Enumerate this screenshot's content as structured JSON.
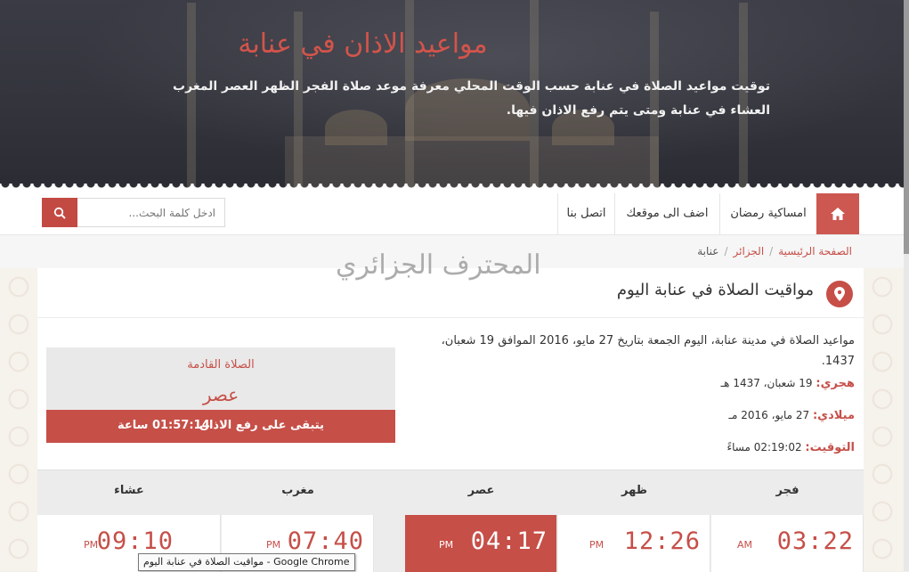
{
  "hero": {
    "title": "مواعيد الاذان في عنابة",
    "subtitle": "توقيت مواعيد الصلاة في عنابة حسب الوقت المحلي معرفة موعد صلاة الفجر الظهر العصر المغرب العشاء في عنابة ومتى يتم رفع الاذان فيها."
  },
  "nav": {
    "items": [
      "امساكية رمضان",
      "اضف الى موقعك",
      "اتصل بنا"
    ],
    "home_icon": "home-icon",
    "search_placeholder": "ادخل كلمة البحث...",
    "search_icon": "search-icon"
  },
  "breadcrumb": {
    "home": "الصفحة الرئيسية",
    "country": "الجزائر",
    "city": "عنابة"
  },
  "watermark": "المحترف الجزائري",
  "section": {
    "title": "مواقيت الصلاة في عنابة اليوم",
    "description": "مواعيد الصلاة في مدينة عنابة، اليوم الجمعة بتاريخ 27 مايو، 2016 الموافق 19 شعبان، 1437.",
    "hijri_label": "هجري:",
    "hijri_value": "19 شعبان، 1437 هـ",
    "gregorian_label": "ميلادي:",
    "gregorian_value": "27 مايو، 2016 مـ",
    "time_label": "التوقيت:",
    "time_value": "02:19:02 مساءً"
  },
  "next_prayer": {
    "label": "الصلاة القادمة",
    "name": "عصر",
    "remaining_label": "يتبقى على رفع الاذان",
    "remaining_time": "01:57:14 ساعة"
  },
  "prayers": [
    {
      "name": "فجر",
      "time": "03:22",
      "ampm": "AM"
    },
    {
      "name": "ظهر",
      "time": "12:26",
      "ampm": "PM"
    },
    {
      "name": "عصر",
      "time": "04:17",
      "ampm": "PM"
    },
    {
      "name": "مغرب",
      "time": "07:40",
      "ampm": "PM"
    },
    {
      "name": "عشاء",
      "time": "09:10",
      "ampm": "PM"
    }
  ],
  "tooltip": "مواقيت الصلاة في عنابة اليوم - Google Chrome",
  "colors": {
    "accent": "#c64f48",
    "hero_bg": "#33343c"
  }
}
